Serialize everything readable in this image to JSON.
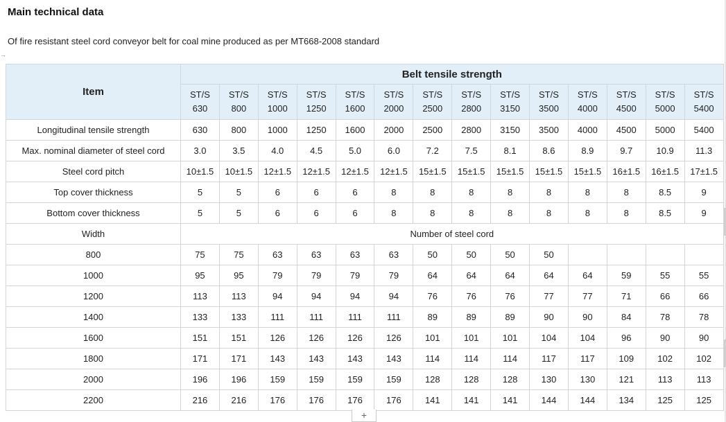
{
  "document": {
    "title": "Main technical data",
    "subtitle": "Of fire resistant steel cord conveyor belt for coal mine produced as per MT668-2008 standard",
    "margin_marker": "→",
    "add_button_label": "+"
  },
  "table": {
    "item_header": "Item",
    "group_header": "Belt tensile strength",
    "grades": [
      [
        "ST/S",
        "630"
      ],
      [
        "ST/S",
        "800"
      ],
      [
        "ST/S",
        "1000"
      ],
      [
        "ST/S",
        "1250"
      ],
      [
        "ST/S",
        "1600"
      ],
      [
        "ST/S",
        "2000"
      ],
      [
        "ST/S",
        "2500"
      ],
      [
        "ST/S",
        "2800"
      ],
      [
        "ST/S",
        "3150"
      ],
      [
        "ST/S",
        "3500"
      ],
      [
        "ST/S",
        "4000"
      ],
      [
        "ST/S",
        "4500"
      ],
      [
        "ST/S",
        "5000"
      ],
      [
        "ST/S",
        "5400"
      ]
    ],
    "spec_rows": [
      {
        "label": "Longitudinal tensile strength",
        "values": [
          "630",
          "800",
          "1000",
          "1250",
          "1600",
          "2000",
          "2500",
          "2800",
          "3150",
          "3500",
          "4000",
          "4500",
          "5000",
          "5400"
        ]
      },
      {
        "label": "Max. nominal diameter of steel cord",
        "values": [
          "3.0",
          "3.5",
          "4.0",
          "4.5",
          "5.0",
          "6.0",
          "7.2",
          "7.5",
          "8.1",
          "8.6",
          "8.9",
          "9.7",
          "10.9",
          "11.3"
        ]
      },
      {
        "label": "Steel cord pitch",
        "values": [
          "10±1.5",
          "10±1.5",
          "12±1.5",
          "12±1.5",
          "12±1.5",
          "12±1.5",
          "15±1.5",
          "15±1.5",
          "15±1.5",
          "15±1.5",
          "15±1.5",
          "16±1.5",
          "16±1.5",
          "17±1.5"
        ]
      },
      {
        "label": "Top cover thickness",
        "values": [
          "5",
          "5",
          "6",
          "6",
          "6",
          "8",
          "8",
          "8",
          "8",
          "8",
          "8",
          "8",
          "8.5",
          "9"
        ]
      },
      {
        "label": "Bottom cover thickness",
        "values": [
          "5",
          "5",
          "6",
          "6",
          "6",
          "8",
          "8",
          "8",
          "8",
          "8",
          "8",
          "8",
          "8.5",
          "9"
        ]
      }
    ],
    "width_label": "Width",
    "cord_count_label": "Number of steel cord",
    "width_rows": [
      {
        "width": "800",
        "values": [
          "75",
          "75",
          "63",
          "63",
          "63",
          "63",
          "50",
          "50",
          "50",
          "50",
          "",
          "",
          "",
          ""
        ]
      },
      {
        "width": "1000",
        "values": [
          "95",
          "95",
          "79",
          "79",
          "79",
          "79",
          "64",
          "64",
          "64",
          "64",
          "64",
          "59",
          "55",
          "55"
        ]
      },
      {
        "width": "1200",
        "values": [
          "113",
          "113",
          "94",
          "94",
          "94",
          "94",
          "76",
          "76",
          "76",
          "77",
          "77",
          "71",
          "66",
          "66"
        ]
      },
      {
        "width": "1400",
        "values": [
          "133",
          "133",
          "111",
          "111",
          "111",
          "111",
          "89",
          "89",
          "89",
          "90",
          "90",
          "84",
          "78",
          "78"
        ]
      },
      {
        "width": "1600",
        "values": [
          "151",
          "151",
          "126",
          "126",
          "126",
          "126",
          "101",
          "101",
          "101",
          "104",
          "104",
          "96",
          "90",
          "90"
        ]
      },
      {
        "width": "1800",
        "values": [
          "171",
          "171",
          "143",
          "143",
          "143",
          "143",
          "114",
          "114",
          "114",
          "117",
          "117",
          "109",
          "102",
          "102"
        ]
      },
      {
        "width": "2000",
        "values": [
          "196",
          "196",
          "159",
          "159",
          "159",
          "159",
          "128",
          "128",
          "128",
          "130",
          "130",
          "121",
          "113",
          "113"
        ]
      },
      {
        "width": "2200",
        "values": [
          "216",
          "216",
          "176",
          "176",
          "176",
          "176",
          "141",
          "141",
          "141",
          "144",
          "144",
          "134",
          "125",
          "125"
        ]
      }
    ]
  }
}
